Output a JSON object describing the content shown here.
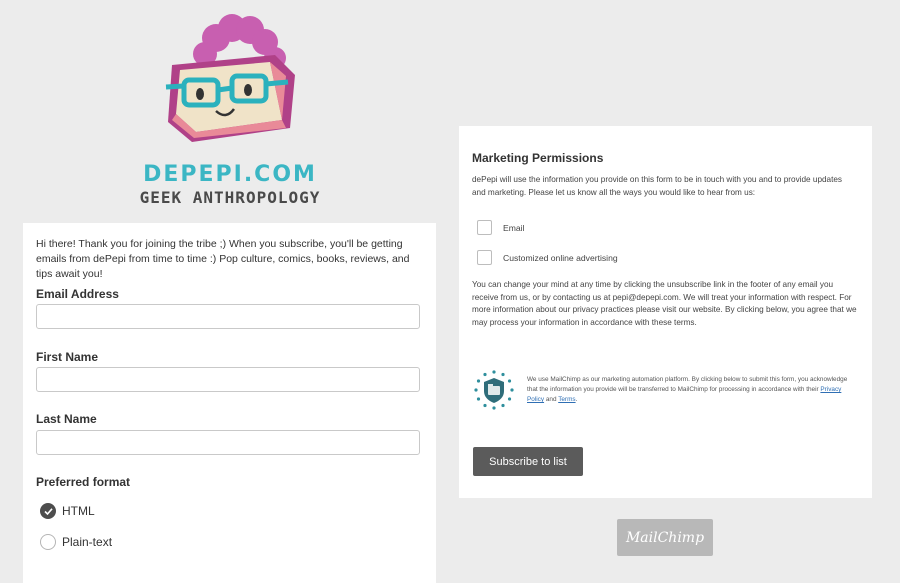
{
  "logo": {
    "title": "DEPEPI.COM",
    "subtitle": "GEEK ANTHROPOLOGY"
  },
  "signup": {
    "intro": "Hi there! Thank you for joining the tribe ;) When you subscribe, you'll be getting emails from dePepi from time to time :) Pop culture, comics, books, reviews, and tips await you!",
    "email_label": "Email Address",
    "first_name_label": "First Name",
    "last_name_label": "Last Name",
    "format_label": "Preferred format",
    "formats": [
      {
        "label": "HTML",
        "selected": true
      },
      {
        "label": "Plain-text",
        "selected": false
      }
    ]
  },
  "permissions": {
    "title": "Marketing Permissions",
    "description": "dePepi will use the information you provide on this form to be in touch with you and to provide updates and marketing. Please let us know all the ways you would like to hear from us:",
    "options": [
      {
        "label": "Email",
        "checked": false
      },
      {
        "label": "Customized online advertising",
        "checked": false
      }
    ],
    "change_text": "You can change your mind at any time by clicking the unsubscribe link in the footer of any email you receive from us, or by contacting us at pepi@depepi.com. We will treat your information with respect. For more information about our privacy practices please visit our website. By clicking below, you agree that we may process your information in accordance with these terms.",
    "mailchimp_text_1": "We use MailChimp as our marketing automation platform. By clicking below to submit this form, you acknowledge that the information you provide will be transferred to MailChimp for processing in accordance with their",
    "privacy_link": "Privacy Policy",
    "and_text": "and",
    "terms_link": "Terms",
    "subscribe_label": "Subscribe to list"
  },
  "badge": {
    "label": "MailChimp"
  },
  "colors": {
    "brand_teal": "#3bb6c4",
    "brand_pink": "#c0408e",
    "button_gray": "#5b5b5b"
  }
}
